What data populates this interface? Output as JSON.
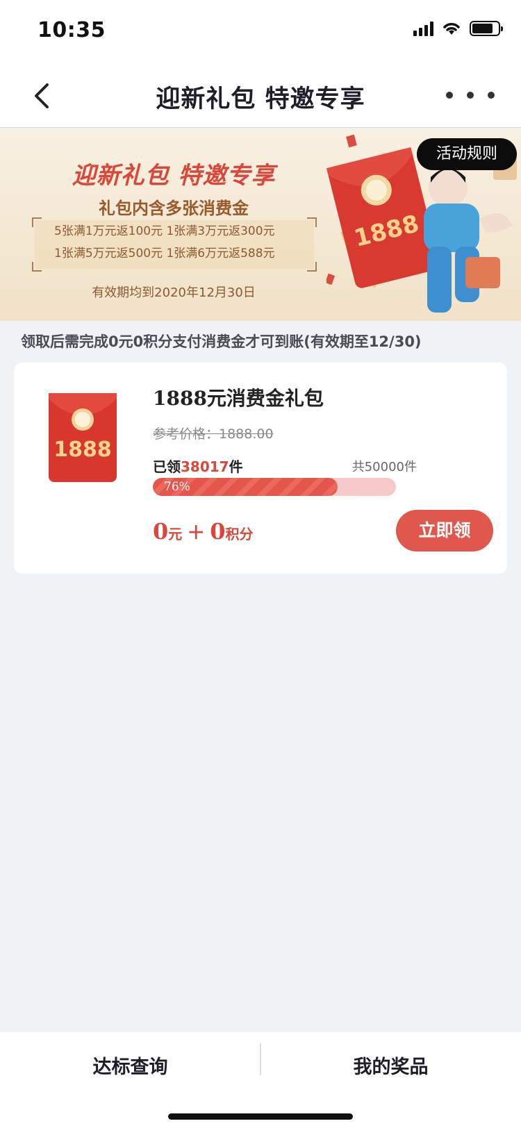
{
  "status_bar": {
    "time": "10:35"
  },
  "nav": {
    "title": "迎新礼包 特邀专享"
  },
  "banner": {
    "title": "迎新礼包 特邀专享",
    "subtitle": "礼包内含多张消费金",
    "lines": [
      "5张满1万元返100元   1张满3万元返300元",
      "1张满5万元返500元   1张满6万元返588元"
    ],
    "validity": "有效期均到2020年12月30日",
    "rules_label": "活动规则",
    "envelope_text": "1888"
  },
  "notice": "领取后需完成0元0积分支付消费金才可到账(有效期至12/30)",
  "product": {
    "name": "1888元消费金礼包",
    "ref_price": "参考价格：1888.00",
    "claimed_prefix": "已领",
    "claimed_count": "38017",
    "claimed_suffix": "件",
    "total": "共50000件",
    "progress": 0.76,
    "progress_label": "76%",
    "price_cash": "0",
    "price_cash_unit": "元",
    "price_plus": "＋",
    "price_points": "0",
    "price_points_unit": "积分",
    "claim_label": "立即领",
    "thumb_text": "1888"
  },
  "tabs": {
    "left": "达标查询",
    "right": "我的奖品"
  },
  "colors": {
    "accent": "#e0574e",
    "background": "#eff3f6"
  }
}
